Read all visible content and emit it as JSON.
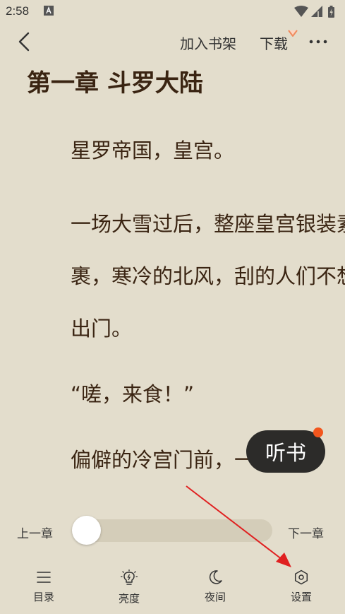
{
  "status_bar": {
    "time": "2:58"
  },
  "top_bar": {
    "add_to_shelf": "加入书架",
    "download": "下载"
  },
  "content": {
    "chapter_title": "第一章 斗罗大陆",
    "para1": "星罗帝国，皇宫。",
    "para2": "一场大雪过后，整座皇宫银装素裹，寒冷的北风，刮的人们不想出门。",
    "para3": "“嗟，来食！”",
    "para4": "偏僻的冷宫门前，一名穿"
  },
  "listen_button": {
    "label": "听书"
  },
  "chapter_nav": {
    "prev": "上一章",
    "next": "下一章",
    "progress": 0.0
  },
  "bottom_nav": {
    "toc": "目录",
    "brightness": "亮度",
    "night": "夜间",
    "settings": "设置"
  },
  "colors": {
    "background": "#e3ddcc",
    "text": "#3a2412",
    "listen_bg": "#2c2b29",
    "badge": "#f2561d",
    "annotation_arrow": "#e02020"
  }
}
